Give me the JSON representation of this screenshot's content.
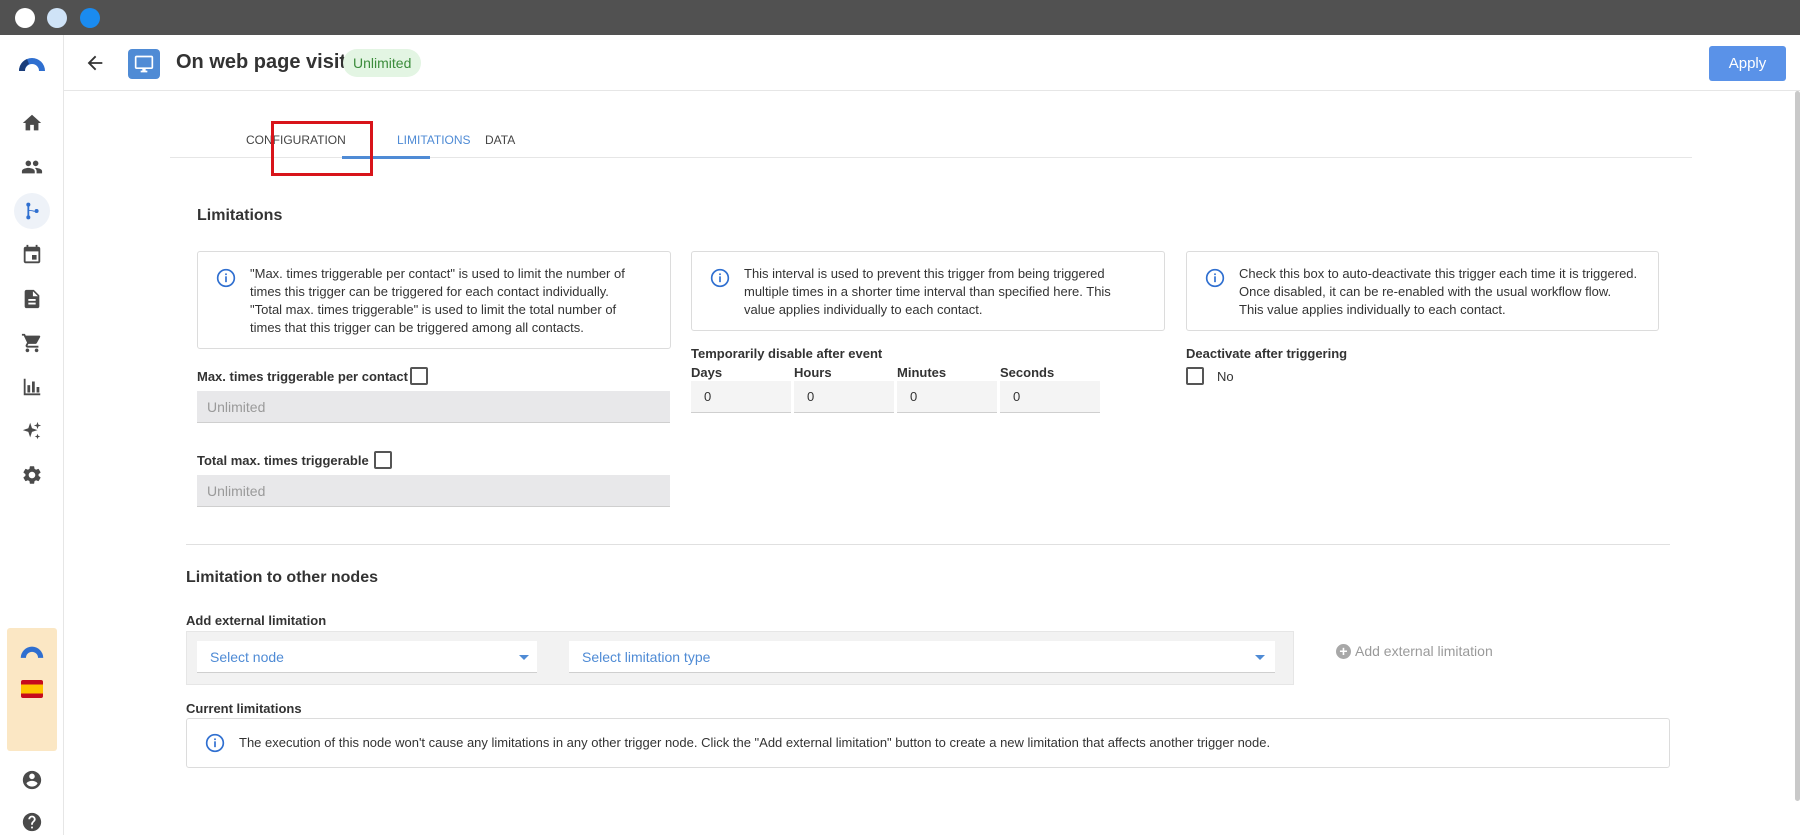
{
  "header": {
    "title": "On web page visit",
    "badge": "Unlimited",
    "apply_label": "Apply"
  },
  "sidebar": {
    "items": [
      {
        "icon": "home-icon"
      },
      {
        "icon": "contacts-icon"
      },
      {
        "icon": "workflow-icon",
        "active": true
      },
      {
        "icon": "calendar-icon"
      },
      {
        "icon": "document-icon"
      },
      {
        "icon": "cart-icon"
      },
      {
        "icon": "chart-icon"
      },
      {
        "icon": "sparkle-icon"
      },
      {
        "icon": "gear-icon"
      }
    ],
    "bottom_items": [
      {
        "icon": "account-icon"
      },
      {
        "icon": "help-icon"
      }
    ]
  },
  "tabs": [
    {
      "label": "CONFIGURATION"
    },
    {
      "label": "LIMITATIONS",
      "active": true
    },
    {
      "label": "DATA"
    }
  ],
  "limitations": {
    "title": "Limitations",
    "info1": [
      "\"Max. times triggerable per contact\" is used to limit the number of",
      "times this trigger can be triggered for each contact individually.",
      "\"Total max. times triggerable\" is used to limit the total number of",
      "times that this trigger can be triggered among all contacts."
    ],
    "info2": [
      "This interval is used to prevent this trigger from being triggered",
      "multiple times in a shorter time interval than specified here. This",
      "value applies individually to each contact."
    ],
    "info3": [
      "Check this box to auto-deactivate this trigger each time it is triggered.",
      "Once disabled, it can be re-enabled with the usual workflow flow.",
      "This value applies individually to each contact."
    ],
    "max_per_contact_label": "Max. times triggerable per contact",
    "max_per_contact_placeholder": "Unlimited",
    "total_max_label": "Total max. times triggerable",
    "total_max_placeholder": "Unlimited",
    "temp_disable_label": "Temporarily disable after event",
    "days_label": "Days",
    "hours_label": "Hours",
    "minutes_label": "Minutes",
    "seconds_label": "Seconds",
    "days_value": "0",
    "hours_value": "0",
    "minutes_value": "0",
    "seconds_value": "0",
    "deactivate_label": "Deactivate after triggering",
    "deactivate_value": "No"
  },
  "other_nodes": {
    "title": "Limitation to other nodes",
    "add_external_label": "Add external limitation",
    "select_node": "Select node",
    "select_type": "Select limitation type",
    "add_external_button": "Add external limitation",
    "current_label": "Current limitations",
    "current_info": "The execution of this node won't cause any limitations in any other trigger node. Click the \"Add external limitation\" button to create a new limitation that affects another trigger node."
  },
  "colors": {
    "accent": "#4f8bd5",
    "apply": "#5a92e8",
    "badge_bg": "#e3f5e3",
    "badge_text": "#3c8c3c",
    "highlight": "#d8141a"
  }
}
